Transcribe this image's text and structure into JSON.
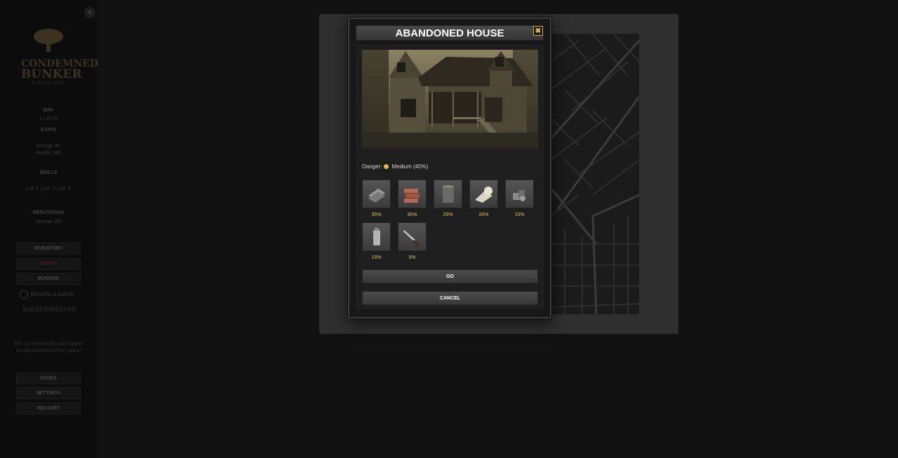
{
  "sidebar": {
    "collapse_icon": "‹",
    "logo_line1": "CONDEMNED",
    "logo_line2": "BUNKER",
    "logo_tagline": "SURVIVAL GAME",
    "day_label": "DAY",
    "day_value": "1 | 12:00",
    "stats_label": "STATS",
    "energy_text": "Energy: 40",
    "health_text": "Health: 100",
    "skills_label": "SKILLS",
    "skills_text": "Lvl: 1 | Cat: 2 | Int: 4",
    "reputation_label": "REPUTATION",
    "reputation_value": "Neutral: 0/0",
    "buttons": [
      "INVENTORY",
      "CRAFT",
      "BUNKER"
    ],
    "patron_text": "Become a patron",
    "sub_logo": "SUBSCRIBESTAR",
    "note": "Join our community and support the development of the game!",
    "bottom_buttons": [
      "SAVES",
      "SETTINGS",
      "RESTART"
    ]
  },
  "modal": {
    "title": "ABANDONED HOUSE",
    "close_icon": "✖",
    "danger_label": "Danger:",
    "danger_value": "Medium (40%)",
    "danger_color": "#e2b84a",
    "loot": [
      {
        "icon": "metal-sheets-icon",
        "chance": "35%"
      },
      {
        "icon": "bricks-icon",
        "chance": "35%"
      },
      {
        "icon": "barrel-icon",
        "chance": "25%"
      },
      {
        "icon": "cloth-roll-icon",
        "chance": "20%"
      },
      {
        "icon": "scrap-pile-icon",
        "chance": "15%"
      },
      {
        "icon": "battery-icon",
        "chance": "15%"
      },
      {
        "icon": "knife-icon",
        "chance": "5%"
      }
    ],
    "go_label": "GO",
    "cancel_label": "CANCEL"
  },
  "colors": {
    "accent": "#e3c45b",
    "background": "#121212",
    "panel": "#2f2f2f"
  }
}
